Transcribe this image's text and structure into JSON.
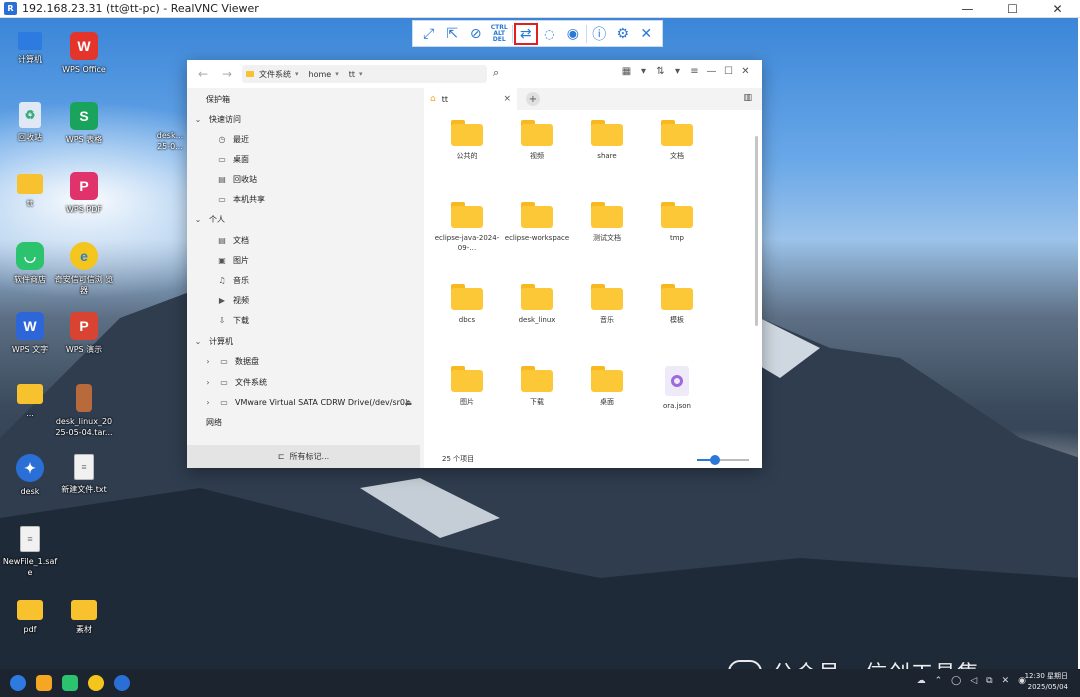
{
  "window": {
    "title": "192.168.23.31 (tt@tt-pc) - RealVNC Viewer",
    "controls": [
      "—",
      "☐",
      "✕"
    ]
  },
  "vnc_toolbar": {
    "buttons": [
      {
        "name": "fullscreen",
        "icon": "expand-icon",
        "glyph": "⤢"
      },
      {
        "name": "scale",
        "icon": "scale-icon",
        "glyph": "⇱"
      },
      {
        "name": "mute",
        "icon": "mute-icon",
        "glyph": "⊘"
      },
      {
        "name": "ctrl-alt-del",
        "icon": "ctrl-alt-del-icon",
        "glyph": "CTRL\nALT\nDEL"
      },
      {
        "name": "file-transfer",
        "icon": "file-transfer-icon",
        "glyph": "⇄",
        "active": true
      },
      {
        "name": "chat",
        "icon": "chat-icon",
        "glyph": "💬"
      },
      {
        "name": "record",
        "icon": "record-icon",
        "glyph": "◉"
      },
      {
        "name": "info",
        "icon": "info-icon",
        "glyph": "ⓘ"
      },
      {
        "name": "settings",
        "icon": "gear-icon",
        "glyph": "⚙"
      },
      {
        "name": "close",
        "icon": "close-icon",
        "glyph": "✕"
      }
    ],
    "accent": "#2a78d8",
    "highlight": "#e02020"
  },
  "desktop_icons": [
    {
      "label": "计算机",
      "icon": "computer-icon"
    },
    {
      "label": "WPS Office",
      "icon": "wps-office-icon",
      "glyph": "W"
    },
    {
      "label": "回收站",
      "icon": "recycle-bin-icon",
      "glyph": "♻"
    },
    {
      "label": "WPS 表格",
      "icon": "wps-spreadsheet-icon",
      "glyph": "S"
    },
    {
      "label": "desk...\n25-0...",
      "icon": "partial-file-icon"
    },
    {
      "label": "tt",
      "icon": "folder-icon"
    },
    {
      "label": "WPS PDF",
      "icon": "wps-pdf-icon",
      "glyph": "P"
    },
    {
      "label": "软件商店",
      "icon": "app-store-icon",
      "glyph": "◡"
    },
    {
      "label": "奇安信可信浏\n览器",
      "icon": "browser-icon",
      "glyph": "e"
    },
    {
      "label": "WPS 文字",
      "icon": "wps-writer-icon",
      "glyph": "W"
    },
    {
      "label": "WPS 演示",
      "icon": "wps-presentation-icon",
      "glyph": "P"
    },
    {
      "label": "...",
      "icon": "folder-icon"
    },
    {
      "label": "desk_linux_20\n25-05-04.tar...",
      "icon": "archive-icon"
    },
    {
      "label": "desk",
      "icon": "desk-app-icon",
      "glyph": "✦"
    },
    {
      "label": "新建文件.txt",
      "icon": "text-file-icon",
      "glyph": "≡"
    },
    {
      "label": "NewFile_1.saf\ne",
      "icon": "file-icon",
      "glyph": "≡"
    },
    {
      "label": "pdf",
      "icon": "folder-icon"
    },
    {
      "label": "素材",
      "icon": "folder-icon"
    }
  ],
  "file_manager": {
    "nav": {
      "back": "←",
      "forward": "→"
    },
    "path": [
      "文件系统",
      "home",
      "tt"
    ],
    "search_icon": "⌕",
    "tools": [
      "▦",
      "▾",
      "⇅",
      "▾",
      "≡",
      "—",
      "☐",
      "✕"
    ],
    "sidebar": {
      "sections": [
        {
          "label": "保护箱",
          "type": "header"
        },
        {
          "label": "快速访问",
          "type": "group"
        },
        {
          "label": "最近",
          "icon": "clock-icon",
          "glyph": "◷"
        },
        {
          "label": "桌面",
          "icon": "desktop-icon",
          "glyph": "▭"
        },
        {
          "label": "回收站",
          "icon": "trash-icon",
          "glyph": "▤"
        },
        {
          "label": "本机共享",
          "icon": "share-icon",
          "glyph": "▭"
        },
        {
          "label": "个人",
          "type": "group"
        },
        {
          "label": "文档",
          "icon": "document-icon",
          "glyph": "▤"
        },
        {
          "label": "图片",
          "icon": "picture-icon",
          "glyph": "▣"
        },
        {
          "label": "音乐",
          "icon": "music-icon",
          "glyph": "♫"
        },
        {
          "label": "视频",
          "icon": "video-icon",
          "glyph": "▶"
        },
        {
          "label": "下载",
          "icon": "download-icon",
          "glyph": "⇩"
        },
        {
          "label": "计算机",
          "type": "group"
        },
        {
          "label": "数据盘",
          "icon": "disk-icon",
          "glyph": "▭",
          "expandable": true
        },
        {
          "label": "文件系统",
          "icon": "disk-icon",
          "glyph": "▭",
          "expandable": true
        },
        {
          "label": "VMware Virtual SATA CDRW Drive(/dev/sr0)",
          "icon": "cdrom-icon",
          "glyph": "▭",
          "expandable": true,
          "eject": "⏏"
        },
        {
          "label": "网络",
          "type": "header"
        }
      ],
      "footer": "所有标记..."
    },
    "tab": {
      "label": "tt",
      "close": "×",
      "add": "+"
    },
    "items": [
      {
        "name": "公共的",
        "kind": "folder"
      },
      {
        "name": "视频",
        "kind": "folder"
      },
      {
        "name": "share",
        "kind": "folder"
      },
      {
        "name": "文档",
        "kind": "folder"
      },
      {
        "name": "eclipse-java-2024-09-…",
        "kind": "folder"
      },
      {
        "name": "eclipse-workspace",
        "kind": "folder"
      },
      {
        "name": "测试文档",
        "kind": "folder"
      },
      {
        "name": "tmp",
        "kind": "folder"
      },
      {
        "name": "dbcs",
        "kind": "folder"
      },
      {
        "name": "desk_linux",
        "kind": "folder"
      },
      {
        "name": "音乐",
        "kind": "folder"
      },
      {
        "name": "模板",
        "kind": "folder"
      },
      {
        "name": "图片",
        "kind": "folder"
      },
      {
        "name": "下载",
        "kind": "folder"
      },
      {
        "name": "桌面",
        "kind": "folder"
      },
      {
        "name": "ora.json",
        "kind": "json"
      }
    ],
    "status": "25 个项目",
    "zoom_level": 0.3
  },
  "taskbar": {
    "apps": [
      "start-icon",
      "files-icon",
      "app-store-icon",
      "browser-icon",
      "desk-app-icon"
    ],
    "tray": [
      "☁",
      "⌃",
      "◯",
      "◁",
      "⧉",
      "✕",
      "◉"
    ],
    "time": "12:30 星期日",
    "date": "2025/05/04"
  },
  "watermark": "公众号 · 信创工具集"
}
